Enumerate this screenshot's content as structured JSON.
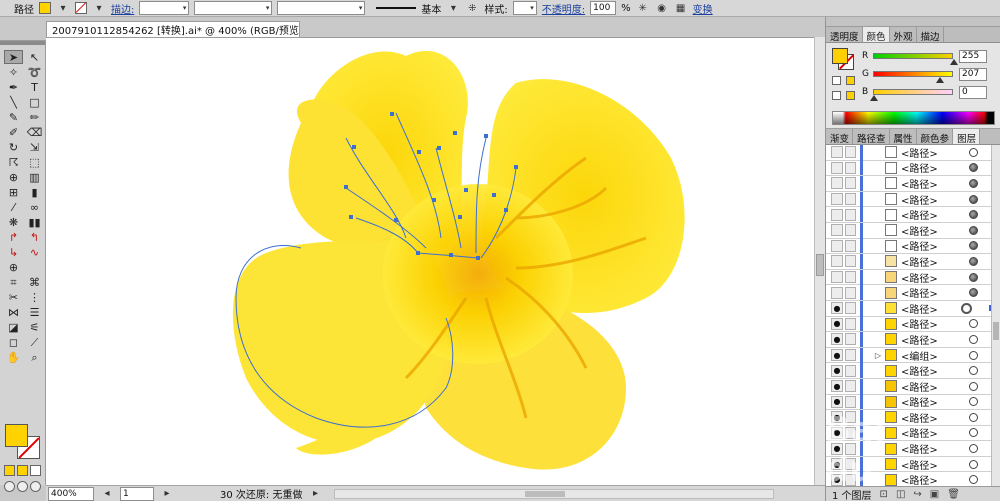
{
  "control_bar": {
    "object_type": "路径",
    "stroke_label": "描边:",
    "stroke_profile_label": "基本",
    "style_label": "样式:",
    "opacity_label": "不透明度:",
    "opacity_value": "100",
    "opacity_unit": "%",
    "transform_label": "变换",
    "fill_color": "#ffd200"
  },
  "document": {
    "tab_title": "2007910112854262 [转换].ai* @ 400% (RGB/预览)"
  },
  "status_bar": {
    "zoom": "400%",
    "artboard": "1",
    "undo_status": "30 次还原: 无重做"
  },
  "color_panel": {
    "tabs": [
      "透明度",
      "颜色",
      "外观",
      "描边"
    ],
    "active_tab": 1,
    "r_label": "R",
    "r_value": "255",
    "g_label": "G",
    "g_value": "207",
    "b_label": "B",
    "b_value": "0"
  },
  "layers_panel": {
    "tabs": [
      "渐变",
      "路径查",
      "属性",
      "颜色参",
      "图层"
    ],
    "active_tab": 4,
    "rows": [
      {
        "name": "<路径>",
        "thumb": "#ffffff",
        "target": "outline"
      },
      {
        "name": "<路径>",
        "thumb": "#ffffff",
        "target": "filled"
      },
      {
        "name": "<路径>",
        "thumb": "#ffffff",
        "target": "filled"
      },
      {
        "name": "<路径>",
        "thumb": "#ffffff",
        "target": "filled"
      },
      {
        "name": "<路径>",
        "thumb": "#ffffff",
        "target": "filled"
      },
      {
        "name": "<路径>",
        "thumb": "#ffffff",
        "target": "filled"
      },
      {
        "name": "<路径>",
        "thumb": "#ffffff",
        "target": "filled"
      },
      {
        "name": "<路径>",
        "thumb": "#f7e3a3",
        "target": "filled"
      },
      {
        "name": "<路径>",
        "thumb": "#f7d67a",
        "target": "filled"
      },
      {
        "name": "<路径>",
        "thumb": "#f7d67a",
        "target": "filled"
      },
      {
        "name": "<路径>",
        "thumb": "#ffe135",
        "target": "selected"
      },
      {
        "name": "<路径>",
        "thumb": "#ffd400",
        "target": "outline"
      },
      {
        "name": "<路径>",
        "thumb": "#ffd400",
        "target": "outline"
      },
      {
        "name": "<编组>",
        "thumb": "#ffd400",
        "target": "outline",
        "group": true
      },
      {
        "name": "<路径>",
        "thumb": "#ffd400",
        "target": "outline"
      },
      {
        "name": "<路径>",
        "thumb": "#f6c400",
        "target": "outline"
      },
      {
        "name": "<路径>",
        "thumb": "#f6c400",
        "target": "outline"
      },
      {
        "name": "<路径>",
        "thumb": "#ffd400",
        "target": "outline"
      },
      {
        "name": "<路径>",
        "thumb": "#ffd400",
        "target": "outline"
      },
      {
        "name": "<路径>",
        "thumb": "#ffd400",
        "target": "outline"
      },
      {
        "name": "<路径>",
        "thumb": "#ffd400",
        "target": "outline"
      },
      {
        "name": "<路径>",
        "thumb": "#ffd400",
        "target": "outline"
      }
    ],
    "footer_label": "1 个图层"
  },
  "canvas": {
    "flower_color": "#ffe12a",
    "center_color": "#f7b800",
    "vein_color": "#e9a300",
    "path_color": "#3d6fcf"
  },
  "watermark": "Bai du"
}
